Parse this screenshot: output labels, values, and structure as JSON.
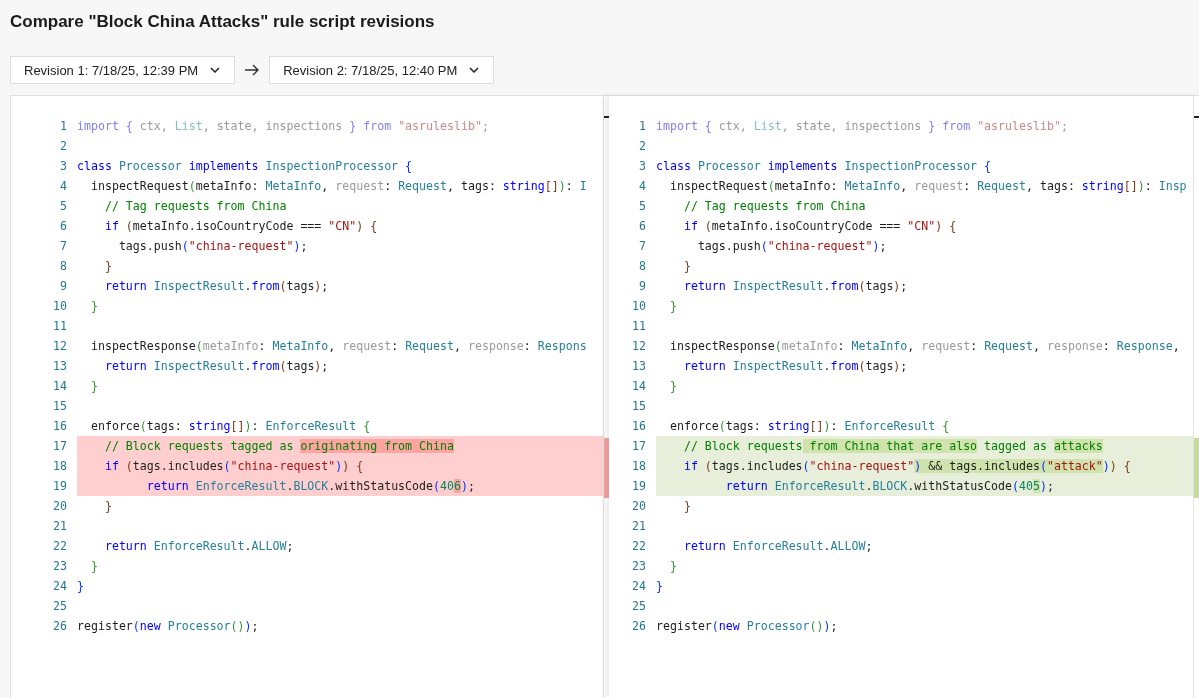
{
  "title": "Compare \"Block China Attacks\" rule script revisions",
  "revisions": [
    {
      "label": "Revision 1: 7/18/25, 12:39 PM"
    },
    {
      "label": "Revision 2: 7/18/25, 12:40 PM"
    }
  ],
  "panes": [
    {
      "kind": "removed",
      "lines": [
        {
          "number": "1",
          "changed": false,
          "tokens": [
            {
              "text": "import",
              "kind": "faded-keyword"
            },
            {
              "text": " {",
              "kind": "faded-keyword"
            },
            {
              "text": " ctx, ",
              "kind": "muted"
            },
            {
              "text": "List",
              "kind": "faded-type"
            },
            {
              "text": ", state, inspections ",
              "kind": "muted"
            },
            {
              "text": "}",
              "kind": "faded-keyword"
            },
            {
              "text": " from",
              "kind": "faded-keyword"
            },
            {
              "text": " \"asruleslib\"",
              "kind": "faded-string"
            },
            {
              "text": ";",
              "kind": "muted"
            }
          ]
        },
        {
          "number": "2",
          "changed": false
        },
        {
          "number": "3",
          "changed": false,
          "tokens": [
            {
              "text": "class",
              "kind": "keyword"
            },
            {
              "text": " Processor",
              "kind": "type"
            },
            {
              "text": " implements",
              "kind": "keyword"
            },
            {
              "text": " InspectionProcessor",
              "kind": "type"
            },
            {
              "text": " {",
              "kind": "bracket1"
            }
          ]
        },
        {
          "number": "4",
          "changed": false,
          "tokens": [
            {
              "text": "  inspectRequest",
              "kind": "plain"
            },
            {
              "text": "(",
              "kind": "bracket2"
            },
            {
              "text": "metaInfo: ",
              "kind": "plain"
            },
            {
              "text": "MetaInfo",
              "kind": "type"
            },
            {
              "text": ", ",
              "kind": "plain"
            },
            {
              "text": "request",
              "kind": "muted"
            },
            {
              "text": ": ",
              "kind": "plain"
            },
            {
              "text": "Request",
              "kind": "type"
            },
            {
              "text": ", tags: ",
              "kind": "plain"
            },
            {
              "text": "string",
              "kind": "keyword"
            },
            {
              "text": "[]",
              "kind": "bracket3"
            },
            {
              "text": ")",
              "kind": "bracket2"
            },
            {
              "text": ": ",
              "kind": "plain"
            },
            {
              "text": "I",
              "kind": "type"
            }
          ]
        },
        {
          "number": "5",
          "changed": false,
          "tokens": [
            {
              "text": "    // Tag requests from China",
              "kind": "comment"
            }
          ]
        },
        {
          "number": "6",
          "changed": false,
          "tokens": [
            {
              "text": "    if",
              "kind": "keyword"
            },
            {
              "text": " (",
              "kind": "bracket3"
            },
            {
              "text": "metaInfo.isoCountryCode === ",
              "kind": "plain"
            },
            {
              "text": "\"CN\"",
              "kind": "string"
            },
            {
              "text": ")",
              "kind": "bracket3"
            },
            {
              "text": " {",
              "kind": "bracket3"
            }
          ]
        },
        {
          "number": "7",
          "changed": false,
          "tokens": [
            {
              "text": "      tags.push",
              "kind": "plain"
            },
            {
              "text": "(",
              "kind": "bracket1"
            },
            {
              "text": "\"china-request\"",
              "kind": "string"
            },
            {
              "text": ")",
              "kind": "bracket1"
            },
            {
              "text": ";",
              "kind": "plain"
            }
          ]
        },
        {
          "number": "8",
          "changed": false,
          "tokens": [
            {
              "text": "    }",
              "kind": "bracket3"
            }
          ]
        },
        {
          "number": "9",
          "changed": false,
          "tokens": [
            {
              "text": "    return",
              "kind": "keyword"
            },
            {
              "text": " InspectResult",
              "kind": "type"
            },
            {
              "text": ".",
              "kind": "plain"
            },
            {
              "text": "from",
              "kind": "keyword"
            },
            {
              "text": "(",
              "kind": "bracket3"
            },
            {
              "text": "tags",
              "kind": "plain"
            },
            {
              "text": ")",
              "kind": "bracket3"
            },
            {
              "text": ";",
              "kind": "plain"
            }
          ]
        },
        {
          "number": "10",
          "changed": false,
          "tokens": [
            {
              "text": "  }",
              "kind": "bracket2"
            }
          ]
        },
        {
          "number": "11",
          "changed": false
        },
        {
          "number": "12",
          "changed": false,
          "tokens": [
            {
              "text": "  inspectResponse",
              "kind": "plain"
            },
            {
              "text": "(",
              "kind": "bracket2"
            },
            {
              "text": "metaInfo",
              "kind": "muted"
            },
            {
              "text": ": ",
              "kind": "plain"
            },
            {
              "text": "MetaInfo",
              "kind": "type"
            },
            {
              "text": ", ",
              "kind": "plain"
            },
            {
              "text": "request",
              "kind": "muted"
            },
            {
              "text": ": ",
              "kind": "plain"
            },
            {
              "text": "Request",
              "kind": "type"
            },
            {
              "text": ", ",
              "kind": "plain"
            },
            {
              "text": "response",
              "kind": "muted"
            },
            {
              "text": ": ",
              "kind": "plain"
            },
            {
              "text": "Respons",
              "kind": "type"
            }
          ]
        },
        {
          "number": "13",
          "changed": false,
          "tokens": [
            {
              "text": "    return",
              "kind": "keyword"
            },
            {
              "text": " InspectResult",
              "kind": "type"
            },
            {
              "text": ".",
              "kind": "plain"
            },
            {
              "text": "from",
              "kind": "keyword"
            },
            {
              "text": "(",
              "kind": "bracket3"
            },
            {
              "text": "tags",
              "kind": "plain"
            },
            {
              "text": ")",
              "kind": "bracket3"
            },
            {
              "text": ";",
              "kind": "plain"
            }
          ]
        },
        {
          "number": "14",
          "changed": false,
          "tokens": [
            {
              "text": "  }",
              "kind": "bracket2"
            }
          ]
        },
        {
          "number": "15",
          "changed": false
        },
        {
          "number": "16",
          "changed": false,
          "tokens": [
            {
              "text": "  enforce",
              "kind": "plain"
            },
            {
              "text": "(",
              "kind": "bracket2"
            },
            {
              "text": "tags: ",
              "kind": "plain"
            },
            {
              "text": "string",
              "kind": "keyword"
            },
            {
              "text": "[]",
              "kind": "bracket3"
            },
            {
              "text": ")",
              "kind": "bracket2"
            },
            {
              "text": ": ",
              "kind": "plain"
            },
            {
              "text": "EnforceResult",
              "kind": "type"
            },
            {
              "text": " {",
              "kind": "bracket2"
            }
          ]
        },
        {
          "number": "17",
          "changed": true,
          "tokens": [
            {
              "text": "    // Block requests tagged as ",
              "kind": "comment",
              "changed": false
            },
            {
              "text": "originating from China",
              "kind": "comment",
              "changed": true
            }
          ]
        },
        {
          "number": "18",
          "changed": true,
          "tokens": [
            {
              "text": "    if",
              "kind": "keyword",
              "changed": false
            },
            {
              "text": " (",
              "kind": "bracket3",
              "changed": false
            },
            {
              "text": "tags.includes",
              "kind": "plain",
              "changed": false
            },
            {
              "text": "(",
              "kind": "bracket1",
              "changed": false
            },
            {
              "text": "\"china-request\"",
              "kind": "string",
              "changed": false
            },
            {
              "text": ")",
              "kind": "bracket1",
              "changed": false
            },
            {
              "text": ")",
              "kind": "bracket3",
              "changed": false
            },
            {
              "text": " {",
              "kind": "bracket3",
              "changed": false
            }
          ]
        },
        {
          "number": "19",
          "changed": true,
          "tokens": [
            {
              "text": "          return",
              "kind": "keyword",
              "changed": false
            },
            {
              "text": " EnforceResult",
              "kind": "type",
              "changed": false
            },
            {
              "text": ".",
              "kind": "plain",
              "changed": false
            },
            {
              "text": "BLOCK",
              "kind": "type",
              "changed": false
            },
            {
              "text": ".withStatusCode",
              "kind": "plain",
              "changed": false
            },
            {
              "text": "(",
              "kind": "bracket1",
              "changed": false
            },
            {
              "text": "40",
              "kind": "number",
              "changed": false
            },
            {
              "text": "6",
              "kind": "number",
              "changed": true
            },
            {
              "text": ")",
              "kind": "bracket1",
              "changed": false
            },
            {
              "text": ";",
              "kind": "plain",
              "changed": false
            }
          ]
        },
        {
          "number": "20",
          "changed": false,
          "tokens": [
            {
              "text": "    }",
              "kind": "bracket3"
            }
          ]
        },
        {
          "number": "21",
          "changed": false
        },
        {
          "number": "22",
          "changed": false,
          "tokens": [
            {
              "text": "    return",
              "kind": "keyword"
            },
            {
              "text": " EnforceResult",
              "kind": "type"
            },
            {
              "text": ".",
              "kind": "plain"
            },
            {
              "text": "ALLOW",
              "kind": "type"
            },
            {
              "text": ";",
              "kind": "plain"
            }
          ]
        },
        {
          "number": "23",
          "changed": false,
          "tokens": [
            {
              "text": "  }",
              "kind": "bracket2"
            }
          ]
        },
        {
          "number": "24",
          "changed": false,
          "tokens": [
            {
              "text": "}",
              "kind": "bracket1"
            }
          ]
        },
        {
          "number": "25",
          "changed": false
        },
        {
          "number": "26",
          "changed": false,
          "tokens": [
            {
              "text": "register",
              "kind": "plain"
            },
            {
              "text": "(",
              "kind": "bracket1"
            },
            {
              "text": "new",
              "kind": "keyword"
            },
            {
              "text": " Processor",
              "kind": "type"
            },
            {
              "text": "()",
              "kind": "bracket2"
            },
            {
              "text": ")",
              "kind": "bracket1"
            },
            {
              "text": ";",
              "kind": "plain"
            }
          ]
        }
      ]
    },
    {
      "kind": "added",
      "lines": [
        {
          "number": "1",
          "changed": false,
          "tokens": [
            {
              "text": "import",
              "kind": "faded-keyword"
            },
            {
              "text": " {",
              "kind": "faded-keyword"
            },
            {
              "text": " ctx, ",
              "kind": "muted"
            },
            {
              "text": "List",
              "kind": "faded-type"
            },
            {
              "text": ", state, inspections ",
              "kind": "muted"
            },
            {
              "text": "}",
              "kind": "faded-keyword"
            },
            {
              "text": " from",
              "kind": "faded-keyword"
            },
            {
              "text": " \"asruleslib\"",
              "kind": "faded-string"
            },
            {
              "text": ";",
              "kind": "muted"
            }
          ]
        },
        {
          "number": "2",
          "changed": false
        },
        {
          "number": "3",
          "changed": false,
          "tokens": [
            {
              "text": "class",
              "kind": "keyword"
            },
            {
              "text": " Processor",
              "kind": "type"
            },
            {
              "text": " implements",
              "kind": "keyword"
            },
            {
              "text": " InspectionProcessor",
              "kind": "type"
            },
            {
              "text": " {",
              "kind": "bracket1"
            }
          ]
        },
        {
          "number": "4",
          "changed": false,
          "tokens": [
            {
              "text": "  inspectRequest",
              "kind": "plain"
            },
            {
              "text": "(",
              "kind": "bracket2"
            },
            {
              "text": "metaInfo: ",
              "kind": "plain"
            },
            {
              "text": "MetaInfo",
              "kind": "type"
            },
            {
              "text": ", ",
              "kind": "plain"
            },
            {
              "text": "request",
              "kind": "muted"
            },
            {
              "text": ": ",
              "kind": "plain"
            },
            {
              "text": "Request",
              "kind": "type"
            },
            {
              "text": ", tags: ",
              "kind": "plain"
            },
            {
              "text": "string",
              "kind": "keyword"
            },
            {
              "text": "[]",
              "kind": "bracket3"
            },
            {
              "text": ")",
              "kind": "bracket2"
            },
            {
              "text": ": ",
              "kind": "plain"
            },
            {
              "text": "Insp",
              "kind": "type"
            }
          ]
        },
        {
          "number": "5",
          "changed": false,
          "tokens": [
            {
              "text": "    // Tag requests from China",
              "kind": "comment"
            }
          ]
        },
        {
          "number": "6",
          "changed": false,
          "tokens": [
            {
              "text": "    if",
              "kind": "keyword"
            },
            {
              "text": " (",
              "kind": "bracket3"
            },
            {
              "text": "metaInfo.isoCountryCode === ",
              "kind": "plain"
            },
            {
              "text": "\"CN\"",
              "kind": "string"
            },
            {
              "text": ")",
              "kind": "bracket3"
            },
            {
              "text": " {",
              "kind": "bracket3"
            }
          ]
        },
        {
          "number": "7",
          "changed": false,
          "tokens": [
            {
              "text": "      tags.push",
              "kind": "plain"
            },
            {
              "text": "(",
              "kind": "bracket1"
            },
            {
              "text": "\"china-request\"",
              "kind": "string"
            },
            {
              "text": ")",
              "kind": "bracket1"
            },
            {
              "text": ";",
              "kind": "plain"
            }
          ]
        },
        {
          "number": "8",
          "changed": false,
          "tokens": [
            {
              "text": "    }",
              "kind": "bracket3"
            }
          ]
        },
        {
          "number": "9",
          "changed": false,
          "tokens": [
            {
              "text": "    return",
              "kind": "keyword"
            },
            {
              "text": " InspectResult",
              "kind": "type"
            },
            {
              "text": ".",
              "kind": "plain"
            },
            {
              "text": "from",
              "kind": "keyword"
            },
            {
              "text": "(",
              "kind": "bracket3"
            },
            {
              "text": "tags",
              "kind": "plain"
            },
            {
              "text": ")",
              "kind": "bracket3"
            },
            {
              "text": ";",
              "kind": "plain"
            }
          ]
        },
        {
          "number": "10",
          "changed": false,
          "tokens": [
            {
              "text": "  }",
              "kind": "bracket2"
            }
          ]
        },
        {
          "number": "11",
          "changed": false
        },
        {
          "number": "12",
          "changed": false,
          "tokens": [
            {
              "text": "  inspectResponse",
              "kind": "plain"
            },
            {
              "text": "(",
              "kind": "bracket2"
            },
            {
              "text": "metaInfo",
              "kind": "muted"
            },
            {
              "text": ": ",
              "kind": "plain"
            },
            {
              "text": "MetaInfo",
              "kind": "type"
            },
            {
              "text": ", ",
              "kind": "plain"
            },
            {
              "text": "request",
              "kind": "muted"
            },
            {
              "text": ": ",
              "kind": "plain"
            },
            {
              "text": "Request",
              "kind": "type"
            },
            {
              "text": ", ",
              "kind": "plain"
            },
            {
              "text": "response",
              "kind": "muted"
            },
            {
              "text": ": ",
              "kind": "plain"
            },
            {
              "text": "Response",
              "kind": "type"
            },
            {
              "text": ",",
              "kind": "plain"
            }
          ]
        },
        {
          "number": "13",
          "changed": false,
          "tokens": [
            {
              "text": "    return",
              "kind": "keyword"
            },
            {
              "text": " InspectResult",
              "kind": "type"
            },
            {
              "text": ".",
              "kind": "plain"
            },
            {
              "text": "from",
              "kind": "keyword"
            },
            {
              "text": "(",
              "kind": "bracket3"
            },
            {
              "text": "tags",
              "kind": "plain"
            },
            {
              "text": ")",
              "kind": "bracket3"
            },
            {
              "text": ";",
              "kind": "plain"
            }
          ]
        },
        {
          "number": "14",
          "changed": false,
          "tokens": [
            {
              "text": "  }",
              "kind": "bracket2"
            }
          ]
        },
        {
          "number": "15",
          "changed": false
        },
        {
          "number": "16",
          "changed": false,
          "tokens": [
            {
              "text": "  enforce",
              "kind": "plain"
            },
            {
              "text": "(",
              "kind": "bracket2"
            },
            {
              "text": "tags: ",
              "kind": "plain"
            },
            {
              "text": "string",
              "kind": "keyword"
            },
            {
              "text": "[]",
              "kind": "bracket3"
            },
            {
              "text": ")",
              "kind": "bracket2"
            },
            {
              "text": ": ",
              "kind": "plain"
            },
            {
              "text": "EnforceResult",
              "kind": "type"
            },
            {
              "text": " {",
              "kind": "bracket2"
            }
          ]
        },
        {
          "number": "17",
          "changed": true,
          "tokens": [
            {
              "text": "    // Block requests",
              "kind": "comment",
              "changed": false
            },
            {
              "text": " from China that are also",
              "kind": "comment",
              "changed": true
            },
            {
              "text": " tagged as ",
              "kind": "comment",
              "changed": false
            },
            {
              "text": "attacks",
              "kind": "comment",
              "changed": true
            }
          ]
        },
        {
          "number": "18",
          "changed": true,
          "tokens": [
            {
              "text": "    if",
              "kind": "keyword",
              "changed": false
            },
            {
              "text": " (",
              "kind": "bracket3",
              "changed": false
            },
            {
              "text": "tags.includes",
              "kind": "plain",
              "changed": false
            },
            {
              "text": "(",
              "kind": "bracket1",
              "changed": false
            },
            {
              "text": "\"china-request\"",
              "kind": "string",
              "changed": false
            },
            {
              "text": ")",
              "kind": "bracket1",
              "changed": true
            },
            {
              "text": " && tags.includes",
              "kind": "plain",
              "changed": true
            },
            {
              "text": "(",
              "kind": "bracket1",
              "changed": true
            },
            {
              "text": "\"attack\"",
              "kind": "string",
              "changed": true
            },
            {
              "text": ")",
              "kind": "bracket1",
              "changed": false
            },
            {
              "text": ")",
              "kind": "bracket3",
              "changed": false
            },
            {
              "text": " {",
              "kind": "bracket3",
              "changed": false
            }
          ]
        },
        {
          "number": "19",
          "changed": true,
          "tokens": [
            {
              "text": "          return",
              "kind": "keyword",
              "changed": false
            },
            {
              "text": " EnforceResult",
              "kind": "type",
              "changed": false
            },
            {
              "text": ".",
              "kind": "plain",
              "changed": false
            },
            {
              "text": "BLOCK",
              "kind": "type",
              "changed": false
            },
            {
              "text": ".withStatusCode",
              "kind": "plain",
              "changed": false
            },
            {
              "text": "(",
              "kind": "bracket1",
              "changed": false
            },
            {
              "text": "40",
              "kind": "number",
              "changed": false
            },
            {
              "text": "5",
              "kind": "number",
              "changed": true
            },
            {
              "text": ")",
              "kind": "bracket1",
              "changed": false
            },
            {
              "text": ";",
              "kind": "plain",
              "changed": false
            }
          ]
        },
        {
          "number": "20",
          "changed": false,
          "tokens": [
            {
              "text": "    }",
              "kind": "bracket3"
            }
          ]
        },
        {
          "number": "21",
          "changed": false
        },
        {
          "number": "22",
          "changed": false,
          "tokens": [
            {
              "text": "    return",
              "kind": "keyword"
            },
            {
              "text": " EnforceResult",
              "kind": "type"
            },
            {
              "text": ".",
              "kind": "plain"
            },
            {
              "text": "ALLOW",
              "kind": "type"
            },
            {
              "text": ";",
              "kind": "plain"
            }
          ]
        },
        {
          "number": "23",
          "changed": false,
          "tokens": [
            {
              "text": "  }",
              "kind": "bracket2"
            }
          ]
        },
        {
          "number": "24",
          "changed": false,
          "tokens": [
            {
              "text": "}",
              "kind": "bracket1"
            }
          ]
        },
        {
          "number": "25",
          "changed": false
        },
        {
          "number": "26",
          "changed": false,
          "tokens": [
            {
              "text": "register",
              "kind": "plain"
            },
            {
              "text": "(",
              "kind": "bracket1"
            },
            {
              "text": "new",
              "kind": "keyword"
            },
            {
              "text": " Processor",
              "kind": "type"
            },
            {
              "text": "()",
              "kind": "bracket2"
            },
            {
              "text": ")",
              "kind": "bracket1"
            },
            {
              "text": ";",
              "kind": "plain"
            }
          ]
        }
      ]
    }
  ]
}
